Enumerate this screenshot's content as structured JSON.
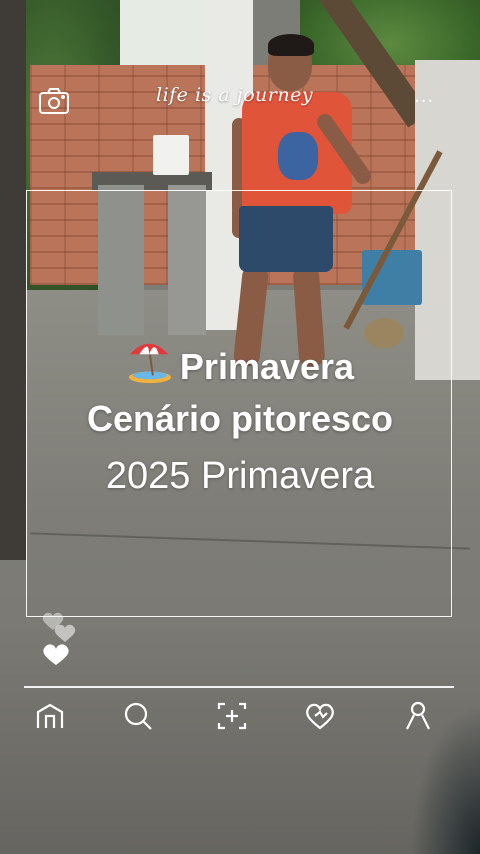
{
  "header": {
    "journey_text": "life is a journey",
    "camera_icon": "camera-icon",
    "more_icon": "more-dots-icon",
    "more_label": "..."
  },
  "overlay": {
    "title_emoji": "beach-umbrella-icon",
    "title_line1": "Primavera",
    "title_line2": "Cenário pitoresco",
    "title_line3": "2025 Primavera"
  },
  "reactions": {
    "icons": [
      "heart-icon",
      "heart-icon",
      "heart-icon"
    ]
  },
  "bottom_nav": {
    "items": [
      {
        "icon": "home-icon"
      },
      {
        "icon": "search-icon"
      },
      {
        "icon": "add-photo-icon"
      },
      {
        "icon": "heart-outline-icon"
      },
      {
        "icon": "profile-icon"
      }
    ]
  },
  "colors": {
    "overlay_text": "#ffffff",
    "frame": "#ffffff"
  }
}
